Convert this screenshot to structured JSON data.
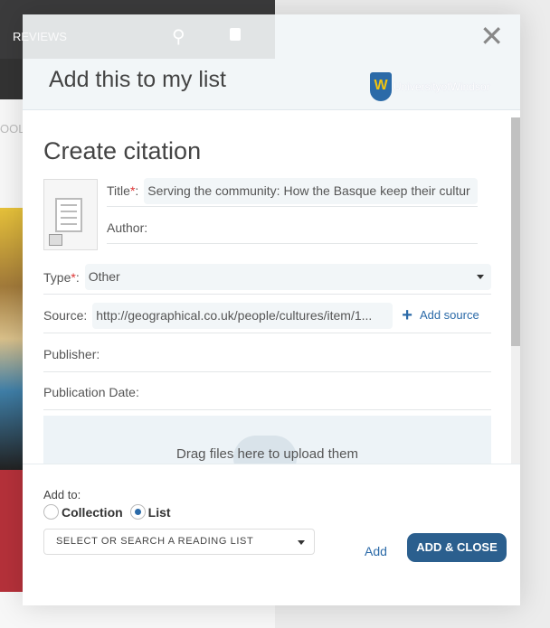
{
  "background": {
    "nav_item": "REVIEWS",
    "tools": "OOLS"
  },
  "modal": {
    "title": "Add this to my list",
    "close_icon": "close-icon",
    "logo_text": "UniversityofWindsor",
    "body": {
      "heading": "Create citation",
      "fields": {
        "title_label": "Title",
        "title_value": "Serving the community: How the Basque keep their cultur",
        "author_label": "Author:",
        "type_label": "Type",
        "type_value": "Other",
        "source_label": "Source:",
        "source_value": "http://geographical.co.uk/people/cultures/item/1...",
        "add_source": "Add source",
        "publisher_label": "Publisher:",
        "date_label": "Publication Date:"
      },
      "required_mark": "*",
      "drop_text": "Drag files here to upload them"
    },
    "footer": {
      "add_to_label": "Add to:",
      "options": [
        {
          "label": "Collection",
          "selected": false
        },
        {
          "label": "List",
          "selected": true
        }
      ],
      "reading_list_placeholder": "SELECT OR SEARCH A READING LIST",
      "add_label": "Add",
      "add_close_label": "ADD & CLOSE"
    }
  },
  "colors": {
    "accent": "#2b6aa8",
    "button": "#2b5f8e",
    "required": "#dd3333"
  }
}
